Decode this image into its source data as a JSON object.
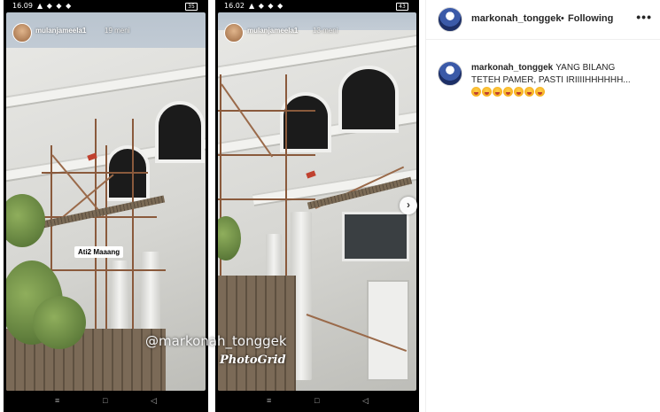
{
  "left_story": {
    "status_time": "16.09",
    "status_icons": "▲ ◆ ◆ ◆",
    "battery": "35",
    "username": "mulanjameela1",
    "time_ago": "19 meni",
    "sticker": "Ati2 Maaang",
    "nav_icons": [
      "≡",
      "□",
      "◁"
    ]
  },
  "right_story": {
    "status_time": "16.02",
    "status_icons": "▲ ◆ ◆ ◆",
    "battery": "43",
    "username": "mulanjameela1",
    "time_ago": "13 meni",
    "nav_icons": [
      "≡",
      "□",
      "◁"
    ]
  },
  "overlay": {
    "watermark": "@markonah_tonggek",
    "app_watermark": "PhotoGrid",
    "next_arrow": "›"
  },
  "post": {
    "username": "markonah_tonggek",
    "separator": "•",
    "follow_status": "Following",
    "more": "•••",
    "comment_user": "markonah_tonggek",
    "comment_text": "YANG BILANG TETEH PAMER, PASTI IRIIIIHHHHHH...",
    "emoji_count": 7
  }
}
